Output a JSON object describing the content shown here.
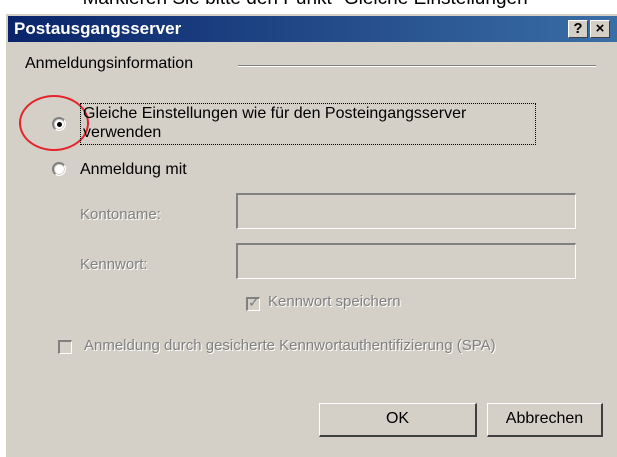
{
  "page": {
    "caption": "Markieren Sie bitte den Punkt \"Gleiche Einstellungen\""
  },
  "dialog": {
    "title": "Postausgangsserver",
    "help_button": "?",
    "close_button": "×",
    "group_label": "Anmeldungsinformation",
    "options": [
      {
        "label": "Gleiche Einstellungen wie für den Posteingangsserver",
        "label_line2": "verwenden",
        "selected": true
      },
      {
        "label": "Anmeldung mit",
        "selected": false
      }
    ],
    "account_label": "Kontoname:",
    "account_value": "",
    "password_label": "Kennwort:",
    "password_value": "",
    "save_password_label": "Kennwort speichern",
    "save_password_checked": true,
    "spa_label": "Anmeldung durch gesicherte Kennwortauthentifizierung (SPA)",
    "spa_checked": false,
    "ok_label": "OK",
    "cancel_label": "Abbrechen"
  },
  "colors": {
    "titlebar": "#0a246a",
    "dialog_bg": "#d4d0c8",
    "highlight_marker": "#e4242a"
  }
}
